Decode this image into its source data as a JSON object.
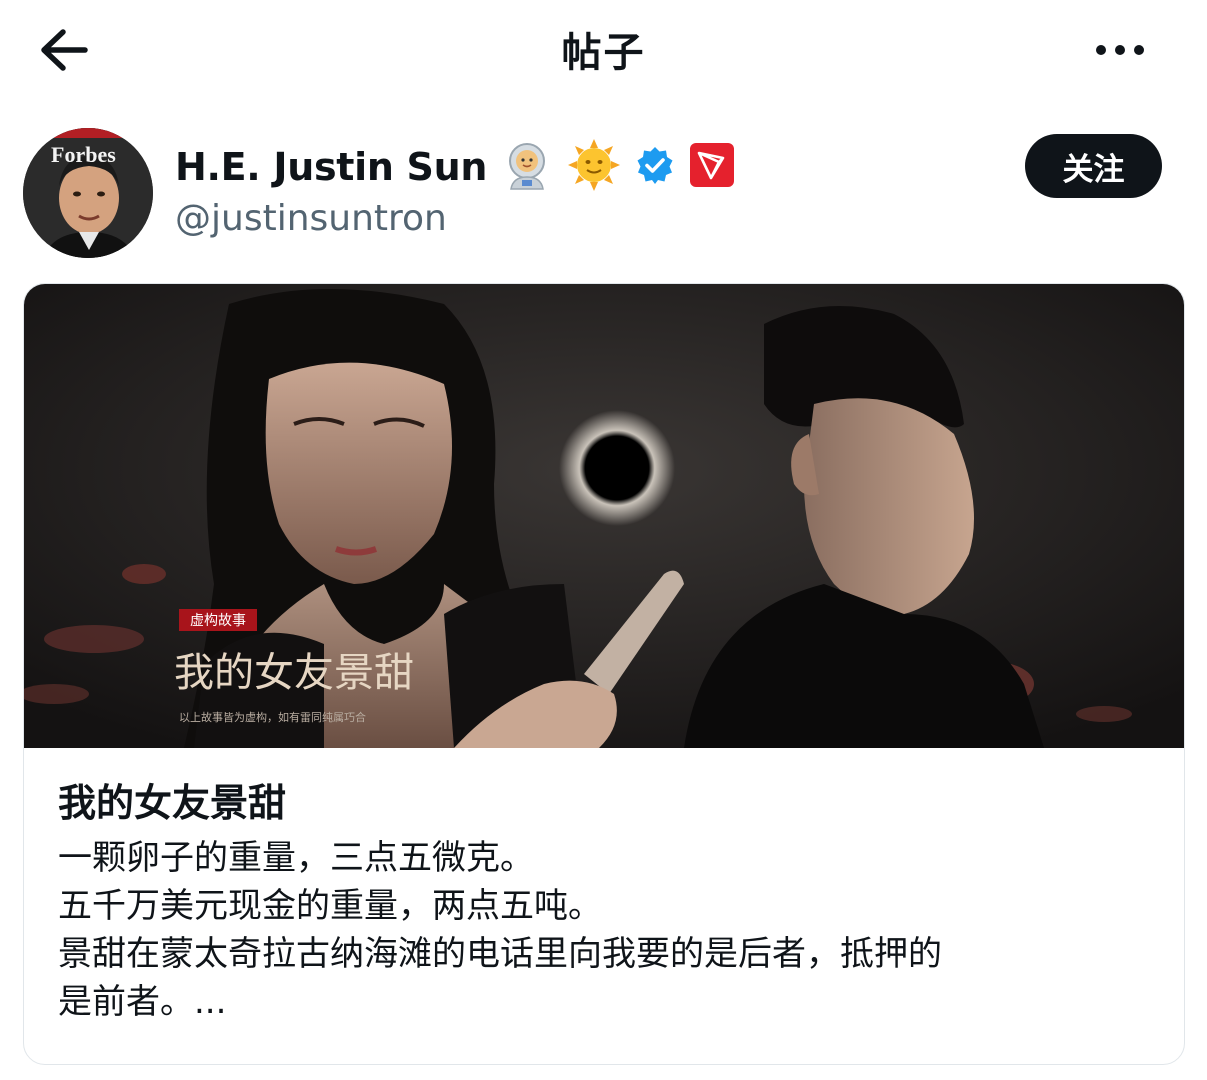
{
  "header": {
    "title": "帖子",
    "back_icon": "arrow-left-icon",
    "more_icon": "more-horizontal-icon"
  },
  "author": {
    "name": "H.E. Justin Sun",
    "handle": "@justinsuntron",
    "badges": [
      "astronaut-emoji-icon",
      "sun-face-emoji-icon",
      "verified-badge-icon",
      "tron-logo-icon"
    ],
    "avatar_label": "Forbes",
    "follow_label": "关注",
    "verified_color": "#1d9bf0"
  },
  "card": {
    "image": {
      "tag": "虚构故事",
      "poster_title": "我的女友景甜",
      "disclaimer": "以上故事皆为虚构，如有雷同纯属巧合"
    },
    "title": "我的女友景甜",
    "lines": [
      "一颗卵子的重量，三点五微克。",
      "五千万美元现金的重量，两点五吨。",
      "景甜在蒙太奇拉古纳海滩的电话里向我要的是后者，抵押的",
      "是前者。..."
    ]
  }
}
